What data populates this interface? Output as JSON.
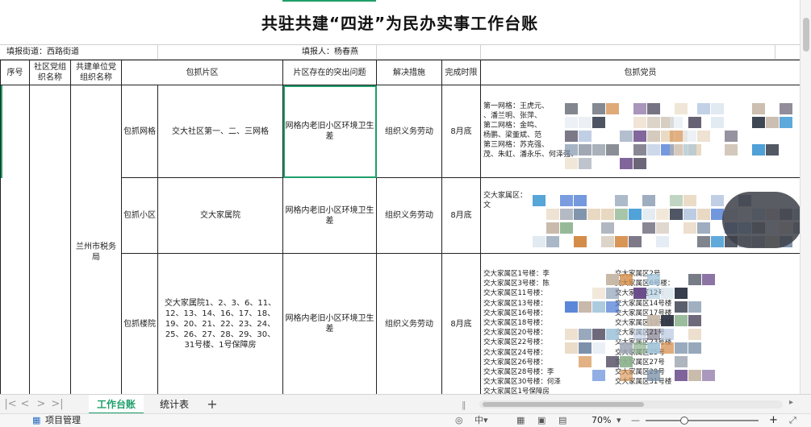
{
  "sheet": {
    "title": "共驻共建“四进”为民办实事工作台账",
    "street_label": "填报街道：西路街道",
    "reporter_label": "填报人：杨春燕",
    "headers": [
      "序号",
      "社区党组织名称",
      "共建单位党组织名称",
      "包抓片区",
      "片区存在的突出问题",
      "解决措施",
      "完成时限",
      "包抓党员"
    ],
    "unit_name": "兰州市税务局",
    "rows": [
      {
        "type": "包抓网格",
        "area": "交大社区第一、二、三网格",
        "problem": "网格内老旧小区环境卫生差",
        "measure": "组织义务劳动",
        "deadline": "8月底",
        "members": [
          "第一网格：王虎元、",
          "、潘兰明、张萍、",
          "第二网格：金鸣、",
          "杨鹏、梁董斌、范",
          "第三网格：苏克强、",
          "茂、朱虹、潘永乐、何泽强、"
        ]
      },
      {
        "type": "包抓小区",
        "area": "交大家属院",
        "problem": "网格内老旧小区环境卫生差",
        "measure": "组织义务劳动",
        "deadline": "8月底",
        "members": [
          "交大家属区：",
          "文"
        ]
      },
      {
        "type": "包抓楼院",
        "area": "交大家属院1、2、3、6、11、12、13、14、16、17、18、19、20、21、22、23、24、25、26、27、28、29、30、31号楼、1号保障房",
        "problem": "网格内老旧小区环境卫生差",
        "measure": "组织义务劳动",
        "deadline": "8月底",
        "members": [
          "交大家属区1号楼：李",
          "交大家属区3号楼：陈",
          "交大家属区11号楼：",
          "交大家属区13号楼：",
          "交大家属区16号楼：",
          "交大家属区18号楼：",
          "交大家属区20号楼：",
          "交大家属区22号楼：",
          "交大家属区24号楼：",
          "交大家属区26号楼：",
          "交大家属区28号楼：李",
          "交大家属区30号楼：何泽",
          "交大家属区1号保障房"
        ],
        "members_right": [
          "交大家属区2号",
          "交大家属区6号楼：",
          "交大家属区12号",
          "交大家属区14号楼",
          "交大家属区17号楼",
          "交大家属区19号楼",
          "交大家属区21号",
          "交大家属区23号楼",
          "交大家属区25号",
          "交大家属区27号",
          "交大家属区29号",
          "交大家属区31号楼"
        ]
      }
    ]
  },
  "tabs": {
    "active": "工作台账",
    "other": "统计表"
  },
  "status": {
    "project_label": "项目管理",
    "zoom": "70%"
  },
  "colors": {
    "accent": "#1e9e6a"
  }
}
